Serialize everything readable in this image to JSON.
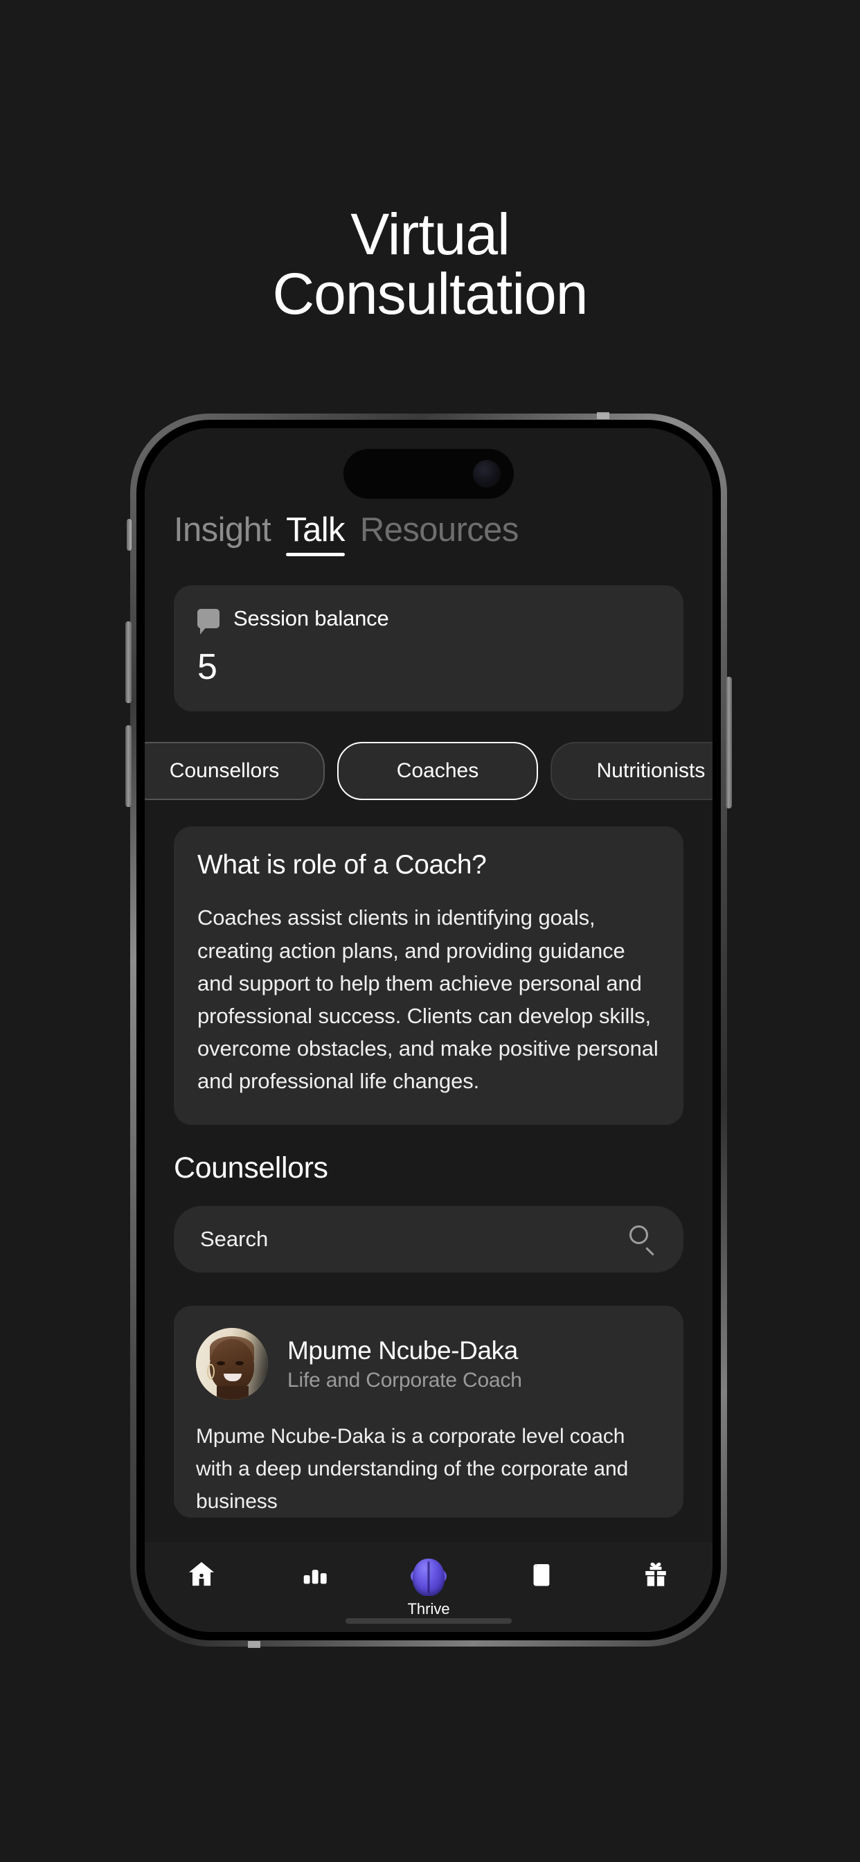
{
  "hero": {
    "line1": "Virtual",
    "line2": "Consultation"
  },
  "colors": {
    "page_background": "#1a1a1a",
    "card_background": "#2b2b2b",
    "accent_purple": "#5f4fd8",
    "text_primary": "#ffffff",
    "text_muted": "#9b9b9b"
  },
  "app": {
    "tabs": [
      {
        "label": "Insight",
        "active": false
      },
      {
        "label": "Talk",
        "active": true
      },
      {
        "label": "Resources",
        "active": false
      }
    ],
    "balance_card": {
      "icon": "chat-bubble-icon",
      "label": "Session balance",
      "value": "5"
    },
    "chips": [
      {
        "label": "Counsellors",
        "selected": false
      },
      {
        "label": "Coaches",
        "selected": true
      },
      {
        "label": "Nutritionists",
        "selected": false
      }
    ],
    "info_card": {
      "title": "What is role of a Coach?",
      "body": "Coaches assist clients in identifying goals, creating action plans, and providing guidance and support to help them achieve personal and professional success. Clients can develop skills, overcome obstacles, and make positive personal and professional life changes."
    },
    "section_heading": "Counsellors",
    "search": {
      "placeholder": "Search",
      "value": "",
      "icon": "search-icon"
    },
    "profile": {
      "name": "Mpume Ncube-Daka",
      "role": "Life and Corporate Coach",
      "bio": "Mpume Ncube-Daka is a corporate level coach with a deep understanding of the corporate and business"
    },
    "bottom_nav": [
      {
        "icon": "home-icon",
        "label": ""
      },
      {
        "icon": "bar-chart-icon",
        "label": ""
      },
      {
        "icon": "thrive-brain-icon",
        "label": "Thrive"
      },
      {
        "icon": "book-icon",
        "label": ""
      },
      {
        "icon": "gift-icon",
        "label": ""
      }
    ]
  }
}
